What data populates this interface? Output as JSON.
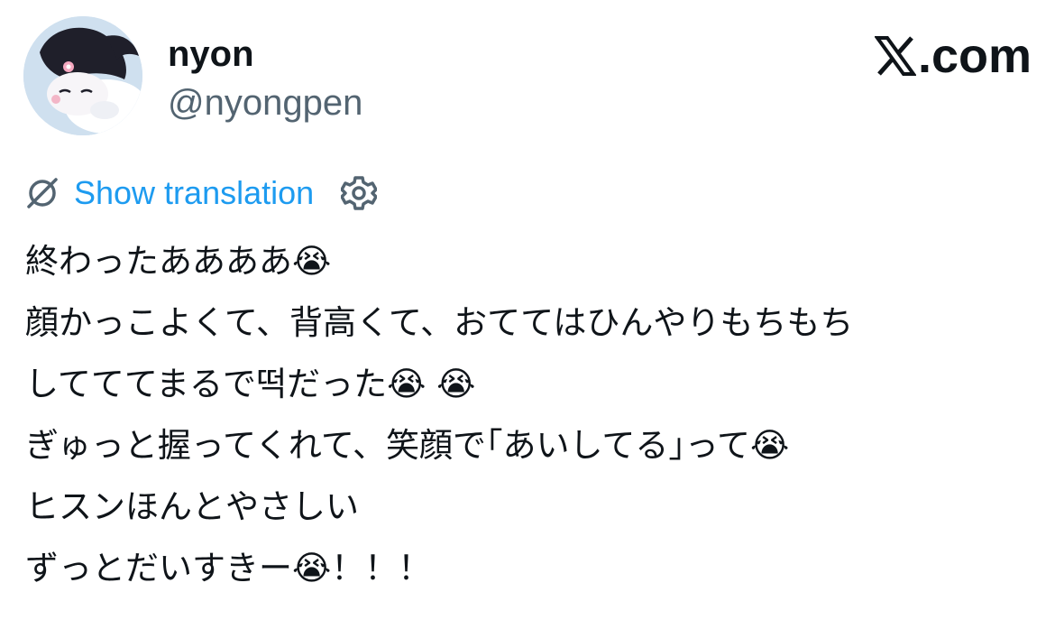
{
  "user": {
    "display_name": "nyon",
    "handle": "@nyongpen",
    "avatar_icon": "kuromi-avatar"
  },
  "brand": {
    "label": ".com",
    "icon": "x-logo-icon"
  },
  "translation": {
    "link_label": "Show translation",
    "icon": "translate-globe-icon",
    "settings_icon": "gear-icon",
    "link_color": "#1d9bf0"
  },
  "tweet": {
    "lines": [
      "終わったああああ😭",
      "顔かっこよくて、背高くて、おててはひんやりもちもち",
      "してててまるで떡だった😭 😭",
      "ぎゅっと握ってくれて、笑顔で｢あいしてる｣って😭",
      "ヒスンほんとやさしい",
      "ずっとだいすきー😭！！！"
    ]
  },
  "colors": {
    "text": "#0f1419",
    "secondary": "#536471",
    "accent": "#1d9bf0"
  }
}
